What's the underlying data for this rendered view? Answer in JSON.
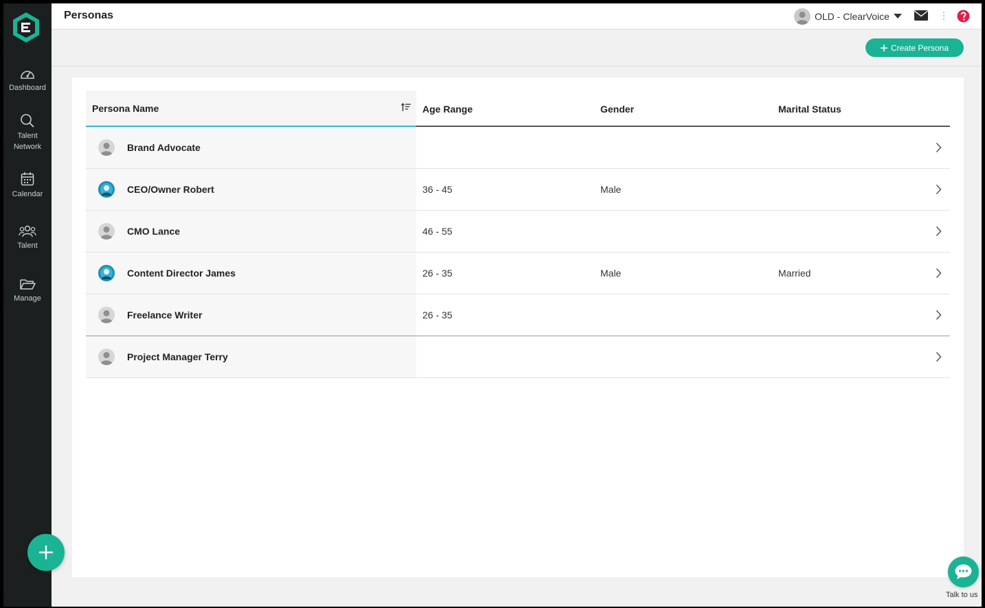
{
  "header": {
    "title": "Personas",
    "account_label": "OLD - ClearVoice"
  },
  "sidebar": {
    "items": [
      {
        "label": "Dashboard",
        "icon": "dashboard-icon"
      },
      {
        "label": "Talent Network",
        "icon": "search-icon"
      },
      {
        "label": "Calendar",
        "icon": "calendar-icon"
      },
      {
        "label": "Talent",
        "icon": "people-icon"
      },
      {
        "label": "Manage",
        "icon": "folder-icon"
      }
    ]
  },
  "toolbar": {
    "create_label": "Create Persona"
  },
  "table": {
    "columns": [
      "Persona Name",
      "Age Range",
      "Gender",
      "Marital Status"
    ],
    "rows": [
      {
        "name": "Brand Advocate",
        "age": "",
        "gender": "",
        "marital": "",
        "avatar": "grey"
      },
      {
        "name": "CEO/Owner Robert",
        "age": "36 - 45",
        "gender": "Male",
        "marital": "",
        "avatar": "blue"
      },
      {
        "name": "CMO Lance",
        "age": "46 - 55",
        "gender": "",
        "marital": "",
        "avatar": "grey"
      },
      {
        "name": "Content Director James",
        "age": "26 - 35",
        "gender": "Male",
        "marital": "Married",
        "avatar": "blue"
      },
      {
        "name": "Freelance Writer",
        "age": "26 - 35",
        "gender": "",
        "marital": "",
        "avatar": "grey"
      },
      {
        "name": "Project Manager Terry",
        "age": "",
        "gender": "",
        "marital": "",
        "avatar": "grey"
      }
    ]
  },
  "chat": {
    "label": "Talk to us"
  },
  "colors": {
    "accent": "#1ab394",
    "sidebar": "#1b1f20",
    "help": "#e0204a",
    "sort_underline": "#35b7c9"
  }
}
